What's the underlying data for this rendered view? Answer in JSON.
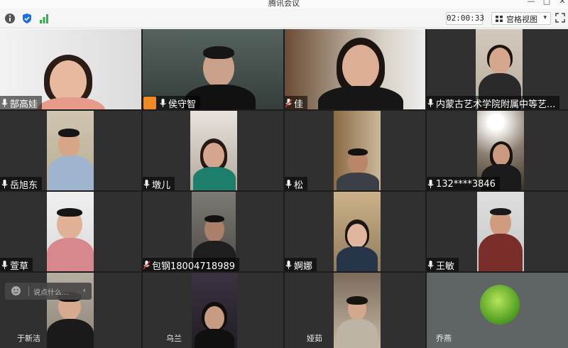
{
  "window": {
    "title": "腾讯会议"
  },
  "toolbar": {
    "icons": [
      "info-icon",
      "shield-icon",
      "signal-bars-icon"
    ],
    "timer": "02:00:33",
    "view_label": "宫格视图",
    "fullscreen_icon": "fullscreen-icon"
  },
  "participants": [
    {
      "name": "郜高娃"
    },
    {
      "name": "侯守智",
      "host": true
    },
    {
      "name": "佳",
      "muted": true
    },
    {
      "name": "内蒙古艺术学院附属中等艺..."
    },
    {
      "name": "岳旭东"
    },
    {
      "name": "墩儿"
    },
    {
      "name": "松"
    },
    {
      "name": "132****3846"
    },
    {
      "name": "萱草"
    },
    {
      "name": "包钢18004718989",
      "muted": true
    },
    {
      "name": "婀娜"
    },
    {
      "name": "王敏"
    },
    {
      "name": "于新洁"
    },
    {
      "name": "乌兰"
    },
    {
      "name": "娅茹"
    },
    {
      "name": "乔燕"
    }
  ],
  "chat": {
    "placeholder": "说点什么..."
  },
  "colors": {
    "host_badge": "#f08a24",
    "shield": "#1e6fd9",
    "signal": "#2db34a"
  }
}
